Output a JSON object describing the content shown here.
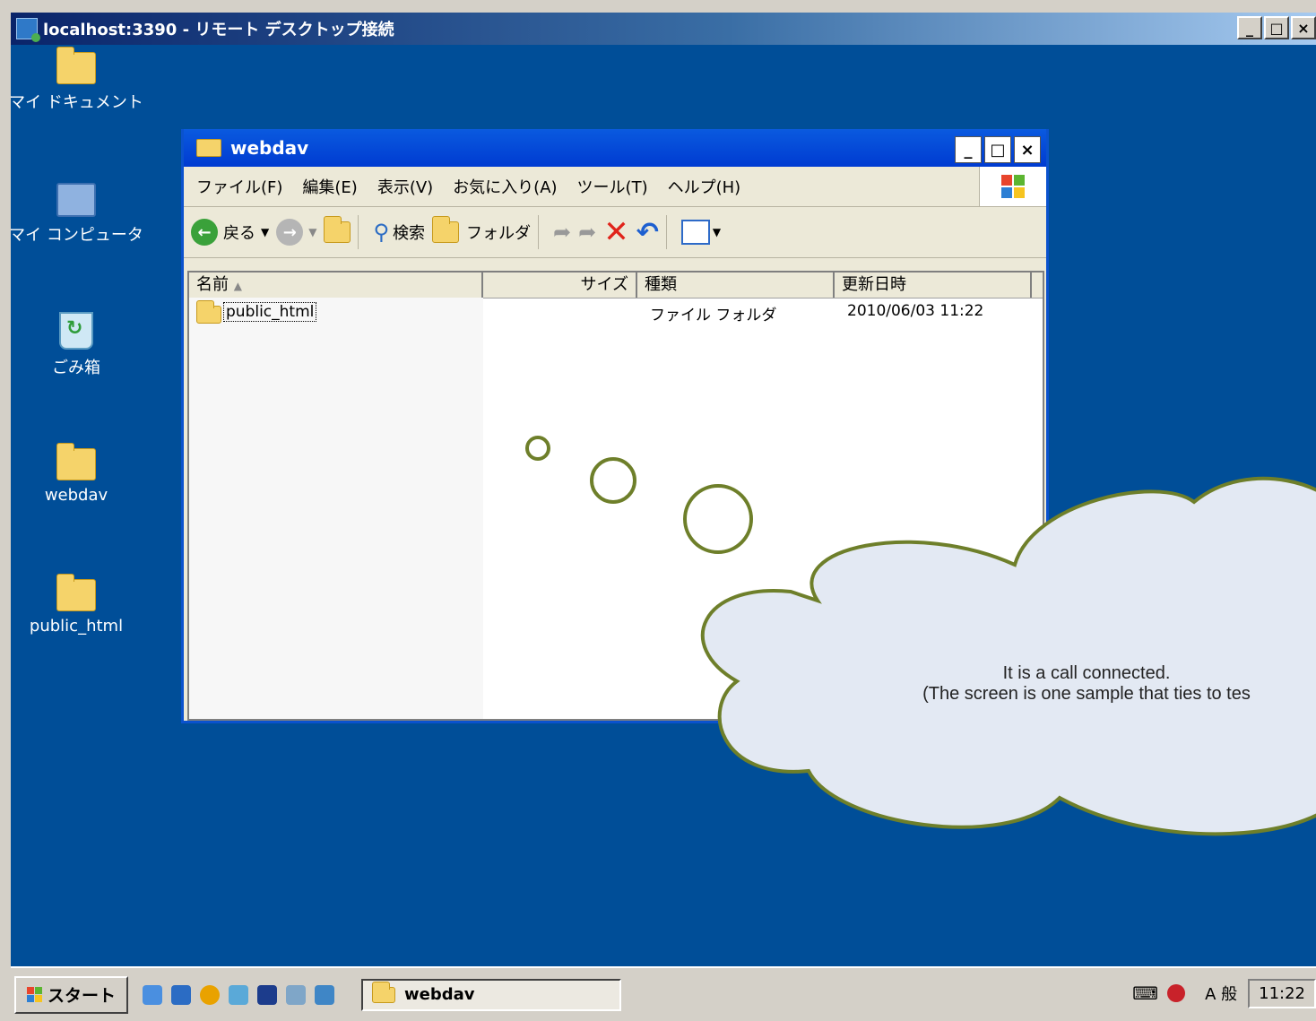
{
  "rdp": {
    "title": "localhost:3390 - リモート デスクトップ接続",
    "min": "_",
    "max": "□",
    "close": "×"
  },
  "desktop_icons": [
    {
      "label": "マイ ドキュメント"
    },
    {
      "label": "マイ コンピュータ"
    },
    {
      "label": "ごみ箱"
    },
    {
      "label": "webdav"
    },
    {
      "label": "public_html"
    }
  ],
  "explorer": {
    "title": "webdav",
    "menu": [
      "ファイル(F)",
      "編集(E)",
      "表示(V)",
      "お気に入り(A)",
      "ツール(T)",
      "ヘルプ(H)"
    ],
    "toolbar": {
      "back": "戻る",
      "search": "検索",
      "folders": "フォルダ"
    },
    "columns": [
      "名前",
      "サイズ",
      "種類",
      "更新日時"
    ],
    "rows": [
      {
        "name": "public_html",
        "size": "",
        "type": "ファイル フォルダ",
        "modified": "2010/06/03 11:22"
      }
    ]
  },
  "callout": {
    "line1": "It is a call connected.",
    "line2": "(The screen is one sample that ties to tes"
  },
  "taskbar": {
    "start": "スタート",
    "task": "webdav",
    "ime": "A 般",
    "clock": "11:22"
  },
  "colors": {
    "desktop": "#004e98",
    "cloud_fill": "#e3e9f3",
    "cloud_stroke": "#6e7f2a"
  }
}
